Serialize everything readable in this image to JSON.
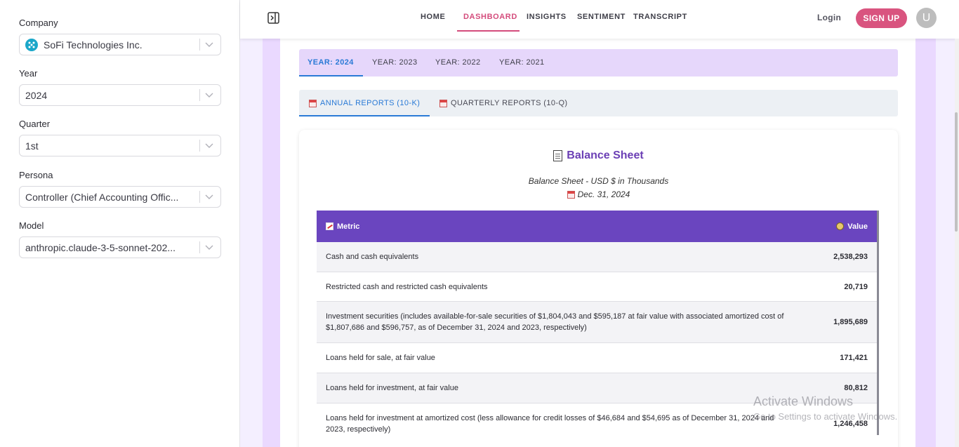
{
  "sidebar": {
    "company": {
      "label": "Company",
      "value": "SoFi Technologies Inc."
    },
    "year": {
      "label": "Year",
      "value": "2024"
    },
    "quarter": {
      "label": "Quarter",
      "value": "1st"
    },
    "persona": {
      "label": "Persona",
      "value": "Controller (Chief Accounting Offic..."
    },
    "model": {
      "label": "Model",
      "value": "anthropic.claude-3-5-sonnet-202..."
    }
  },
  "navbar": {
    "links": [
      "HOME",
      "DASHBOARD",
      "INSIGHTS",
      "SENTIMENT",
      "TRANSCRIPT"
    ],
    "active": "DASHBOARD",
    "login": "Login",
    "signup": "SIGN UP",
    "avatar_initial": "U"
  },
  "year_tabs": [
    "YEAR: 2024",
    "YEAR: 2023",
    "YEAR: 2022",
    "YEAR: 2021"
  ],
  "report_tabs": [
    "ANNUAL REPORTS (10-K)",
    "QUARTERLY REPORTS (10-Q)"
  ],
  "card": {
    "title": "Balance Sheet",
    "subtitle": "Balance Sheet - USD $ in Thousands",
    "date": "Dec. 31, 2024"
  },
  "table": {
    "headers": {
      "metric": "Metric",
      "value": "Value"
    },
    "rows": [
      {
        "metric": "Cash and cash equivalents",
        "value": "2,538,293"
      },
      {
        "metric": "Restricted cash and restricted cash equivalents",
        "value": "20,719"
      },
      {
        "metric": "Investment securities (includes available-for-sale securities of $1,804,043 and $595,187 at fair value with associated amortized cost of $1,807,686 and $596,757, as of December 31, 2024 and 2023, respectively)",
        "value": "1,895,689"
      },
      {
        "metric": "Loans held for sale, at fair value",
        "value": "171,421"
      },
      {
        "metric": "Loans held for investment, at fair value",
        "value": "80,812"
      },
      {
        "metric": "Loans held for investment at amortized cost (less allowance for credit losses of $46,684 and $54,695 as of December 31, 2024 and 2023, respectively)",
        "value": "1,246,458"
      }
    ]
  },
  "watermark": {
    "title": "Activate Windows",
    "subtitle": "Go to Settings to activate Windows."
  },
  "colors": {
    "accent_pink": "#d44c7c",
    "accent_blue": "#2a7ad6",
    "table_header": "#6a45bf",
    "title_purple": "#6b3fb5"
  }
}
